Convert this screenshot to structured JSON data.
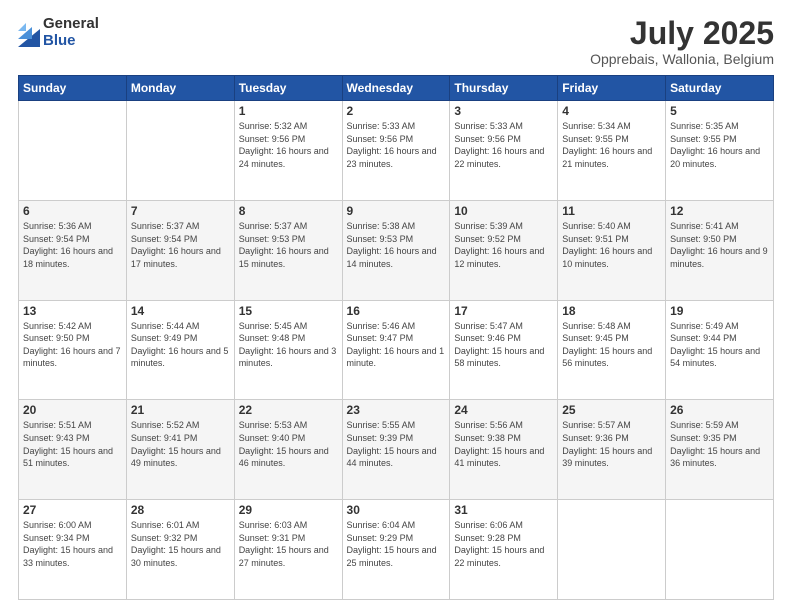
{
  "logo": {
    "general": "General",
    "blue": "Blue"
  },
  "header": {
    "title": "July 2025",
    "subtitle": "Opprebais, Wallonia, Belgium"
  },
  "days_of_week": [
    "Sunday",
    "Monday",
    "Tuesday",
    "Wednesday",
    "Thursday",
    "Friday",
    "Saturday"
  ],
  "weeks": [
    [
      {
        "day": "",
        "sunrise": "",
        "sunset": "",
        "daylight": ""
      },
      {
        "day": "",
        "sunrise": "",
        "sunset": "",
        "daylight": ""
      },
      {
        "day": "1",
        "sunrise": "Sunrise: 5:32 AM",
        "sunset": "Sunset: 9:56 PM",
        "daylight": "Daylight: 16 hours and 24 minutes."
      },
      {
        "day": "2",
        "sunrise": "Sunrise: 5:33 AM",
        "sunset": "Sunset: 9:56 PM",
        "daylight": "Daylight: 16 hours and 23 minutes."
      },
      {
        "day": "3",
        "sunrise": "Sunrise: 5:33 AM",
        "sunset": "Sunset: 9:56 PM",
        "daylight": "Daylight: 16 hours and 22 minutes."
      },
      {
        "day": "4",
        "sunrise": "Sunrise: 5:34 AM",
        "sunset": "Sunset: 9:55 PM",
        "daylight": "Daylight: 16 hours and 21 minutes."
      },
      {
        "day": "5",
        "sunrise": "Sunrise: 5:35 AM",
        "sunset": "Sunset: 9:55 PM",
        "daylight": "Daylight: 16 hours and 20 minutes."
      }
    ],
    [
      {
        "day": "6",
        "sunrise": "Sunrise: 5:36 AM",
        "sunset": "Sunset: 9:54 PM",
        "daylight": "Daylight: 16 hours and 18 minutes."
      },
      {
        "day": "7",
        "sunrise": "Sunrise: 5:37 AM",
        "sunset": "Sunset: 9:54 PM",
        "daylight": "Daylight: 16 hours and 17 minutes."
      },
      {
        "day": "8",
        "sunrise": "Sunrise: 5:37 AM",
        "sunset": "Sunset: 9:53 PM",
        "daylight": "Daylight: 16 hours and 15 minutes."
      },
      {
        "day": "9",
        "sunrise": "Sunrise: 5:38 AM",
        "sunset": "Sunset: 9:53 PM",
        "daylight": "Daylight: 16 hours and 14 minutes."
      },
      {
        "day": "10",
        "sunrise": "Sunrise: 5:39 AM",
        "sunset": "Sunset: 9:52 PM",
        "daylight": "Daylight: 16 hours and 12 minutes."
      },
      {
        "day": "11",
        "sunrise": "Sunrise: 5:40 AM",
        "sunset": "Sunset: 9:51 PM",
        "daylight": "Daylight: 16 hours and 10 minutes."
      },
      {
        "day": "12",
        "sunrise": "Sunrise: 5:41 AM",
        "sunset": "Sunset: 9:50 PM",
        "daylight": "Daylight: 16 hours and 9 minutes."
      }
    ],
    [
      {
        "day": "13",
        "sunrise": "Sunrise: 5:42 AM",
        "sunset": "Sunset: 9:50 PM",
        "daylight": "Daylight: 16 hours and 7 minutes."
      },
      {
        "day": "14",
        "sunrise": "Sunrise: 5:44 AM",
        "sunset": "Sunset: 9:49 PM",
        "daylight": "Daylight: 16 hours and 5 minutes."
      },
      {
        "day": "15",
        "sunrise": "Sunrise: 5:45 AM",
        "sunset": "Sunset: 9:48 PM",
        "daylight": "Daylight: 16 hours and 3 minutes."
      },
      {
        "day": "16",
        "sunrise": "Sunrise: 5:46 AM",
        "sunset": "Sunset: 9:47 PM",
        "daylight": "Daylight: 16 hours and 1 minute."
      },
      {
        "day": "17",
        "sunrise": "Sunrise: 5:47 AM",
        "sunset": "Sunset: 9:46 PM",
        "daylight": "Daylight: 15 hours and 58 minutes."
      },
      {
        "day": "18",
        "sunrise": "Sunrise: 5:48 AM",
        "sunset": "Sunset: 9:45 PM",
        "daylight": "Daylight: 15 hours and 56 minutes."
      },
      {
        "day": "19",
        "sunrise": "Sunrise: 5:49 AM",
        "sunset": "Sunset: 9:44 PM",
        "daylight": "Daylight: 15 hours and 54 minutes."
      }
    ],
    [
      {
        "day": "20",
        "sunrise": "Sunrise: 5:51 AM",
        "sunset": "Sunset: 9:43 PM",
        "daylight": "Daylight: 15 hours and 51 minutes."
      },
      {
        "day": "21",
        "sunrise": "Sunrise: 5:52 AM",
        "sunset": "Sunset: 9:41 PM",
        "daylight": "Daylight: 15 hours and 49 minutes."
      },
      {
        "day": "22",
        "sunrise": "Sunrise: 5:53 AM",
        "sunset": "Sunset: 9:40 PM",
        "daylight": "Daylight: 15 hours and 46 minutes."
      },
      {
        "day": "23",
        "sunrise": "Sunrise: 5:55 AM",
        "sunset": "Sunset: 9:39 PM",
        "daylight": "Daylight: 15 hours and 44 minutes."
      },
      {
        "day": "24",
        "sunrise": "Sunrise: 5:56 AM",
        "sunset": "Sunset: 9:38 PM",
        "daylight": "Daylight: 15 hours and 41 minutes."
      },
      {
        "day": "25",
        "sunrise": "Sunrise: 5:57 AM",
        "sunset": "Sunset: 9:36 PM",
        "daylight": "Daylight: 15 hours and 39 minutes."
      },
      {
        "day": "26",
        "sunrise": "Sunrise: 5:59 AM",
        "sunset": "Sunset: 9:35 PM",
        "daylight": "Daylight: 15 hours and 36 minutes."
      }
    ],
    [
      {
        "day": "27",
        "sunrise": "Sunrise: 6:00 AM",
        "sunset": "Sunset: 9:34 PM",
        "daylight": "Daylight: 15 hours and 33 minutes."
      },
      {
        "day": "28",
        "sunrise": "Sunrise: 6:01 AM",
        "sunset": "Sunset: 9:32 PM",
        "daylight": "Daylight: 15 hours and 30 minutes."
      },
      {
        "day": "29",
        "sunrise": "Sunrise: 6:03 AM",
        "sunset": "Sunset: 9:31 PM",
        "daylight": "Daylight: 15 hours and 27 minutes."
      },
      {
        "day": "30",
        "sunrise": "Sunrise: 6:04 AM",
        "sunset": "Sunset: 9:29 PM",
        "daylight": "Daylight: 15 hours and 25 minutes."
      },
      {
        "day": "31",
        "sunrise": "Sunrise: 6:06 AM",
        "sunset": "Sunset: 9:28 PM",
        "daylight": "Daylight: 15 hours and 22 minutes."
      },
      {
        "day": "",
        "sunrise": "",
        "sunset": "",
        "daylight": ""
      },
      {
        "day": "",
        "sunrise": "",
        "sunset": "",
        "daylight": ""
      }
    ]
  ]
}
